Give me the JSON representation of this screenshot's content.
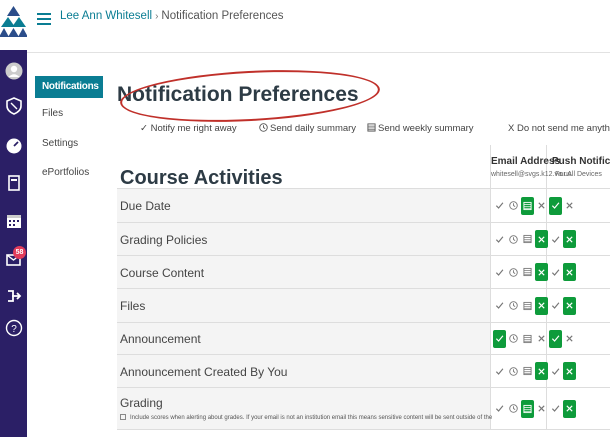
{
  "nav": {
    "items": [
      {
        "name": "account-icon",
        "icon": "user"
      },
      {
        "name": "admin-icon",
        "icon": "shield"
      },
      {
        "name": "dashboard-icon",
        "icon": "gauge"
      },
      {
        "name": "courses-icon",
        "icon": "book"
      },
      {
        "name": "calendar-icon",
        "icon": "calendar"
      },
      {
        "name": "inbox-icon",
        "icon": "inbox",
        "badge": "58"
      },
      {
        "name": "commons-icon",
        "icon": "arrow-right"
      },
      {
        "name": "help-icon",
        "icon": "question"
      }
    ]
  },
  "breadcrumb": {
    "user": "Lee Ann Whitesell",
    "separator": "›",
    "current": "Notification Preferences"
  },
  "course_nav": {
    "items": [
      "Notifications",
      "Files",
      "Settings",
      "ePortfolios"
    ],
    "active": "Notifications"
  },
  "page": {
    "title": "Notification Preferences"
  },
  "legend": {
    "immediately": "✓ Notify me right away",
    "daily": "Send daily summary",
    "weekly": "Send weekly summary",
    "never": "X Do not send me anything"
  },
  "table": {
    "section_title": "Course Activities",
    "columns": [
      {
        "title": "Email Address",
        "subtitle": "whitesell@svgs.k12.va.us"
      },
      {
        "title": "Push Notifications",
        "subtitle": "For All Devices"
      }
    ],
    "rows": [
      {
        "label": "Due Date",
        "email": "weekly",
        "push": "immediately"
      },
      {
        "label": "Grading Policies",
        "email": "never",
        "push": "never"
      },
      {
        "label": "Course Content",
        "email": "never",
        "push": "never"
      },
      {
        "label": "Files",
        "email": "never",
        "push": "never"
      },
      {
        "label": "Announcement",
        "email": "immediately",
        "push": "immediately"
      },
      {
        "label": "Announcement Created By You",
        "email": "never",
        "push": "never"
      },
      {
        "label": "Grading",
        "email": "weekly",
        "push": "never",
        "note": "Include scores when alerting about grades. If your email is not an institution email this means sensitive content will be sent outside of the"
      }
    ]
  },
  "colors": {
    "nav_bg": "#2b1f66",
    "accent": "#0a7d93",
    "selected": "#0e9b3b",
    "annotation": "#c0302a"
  }
}
